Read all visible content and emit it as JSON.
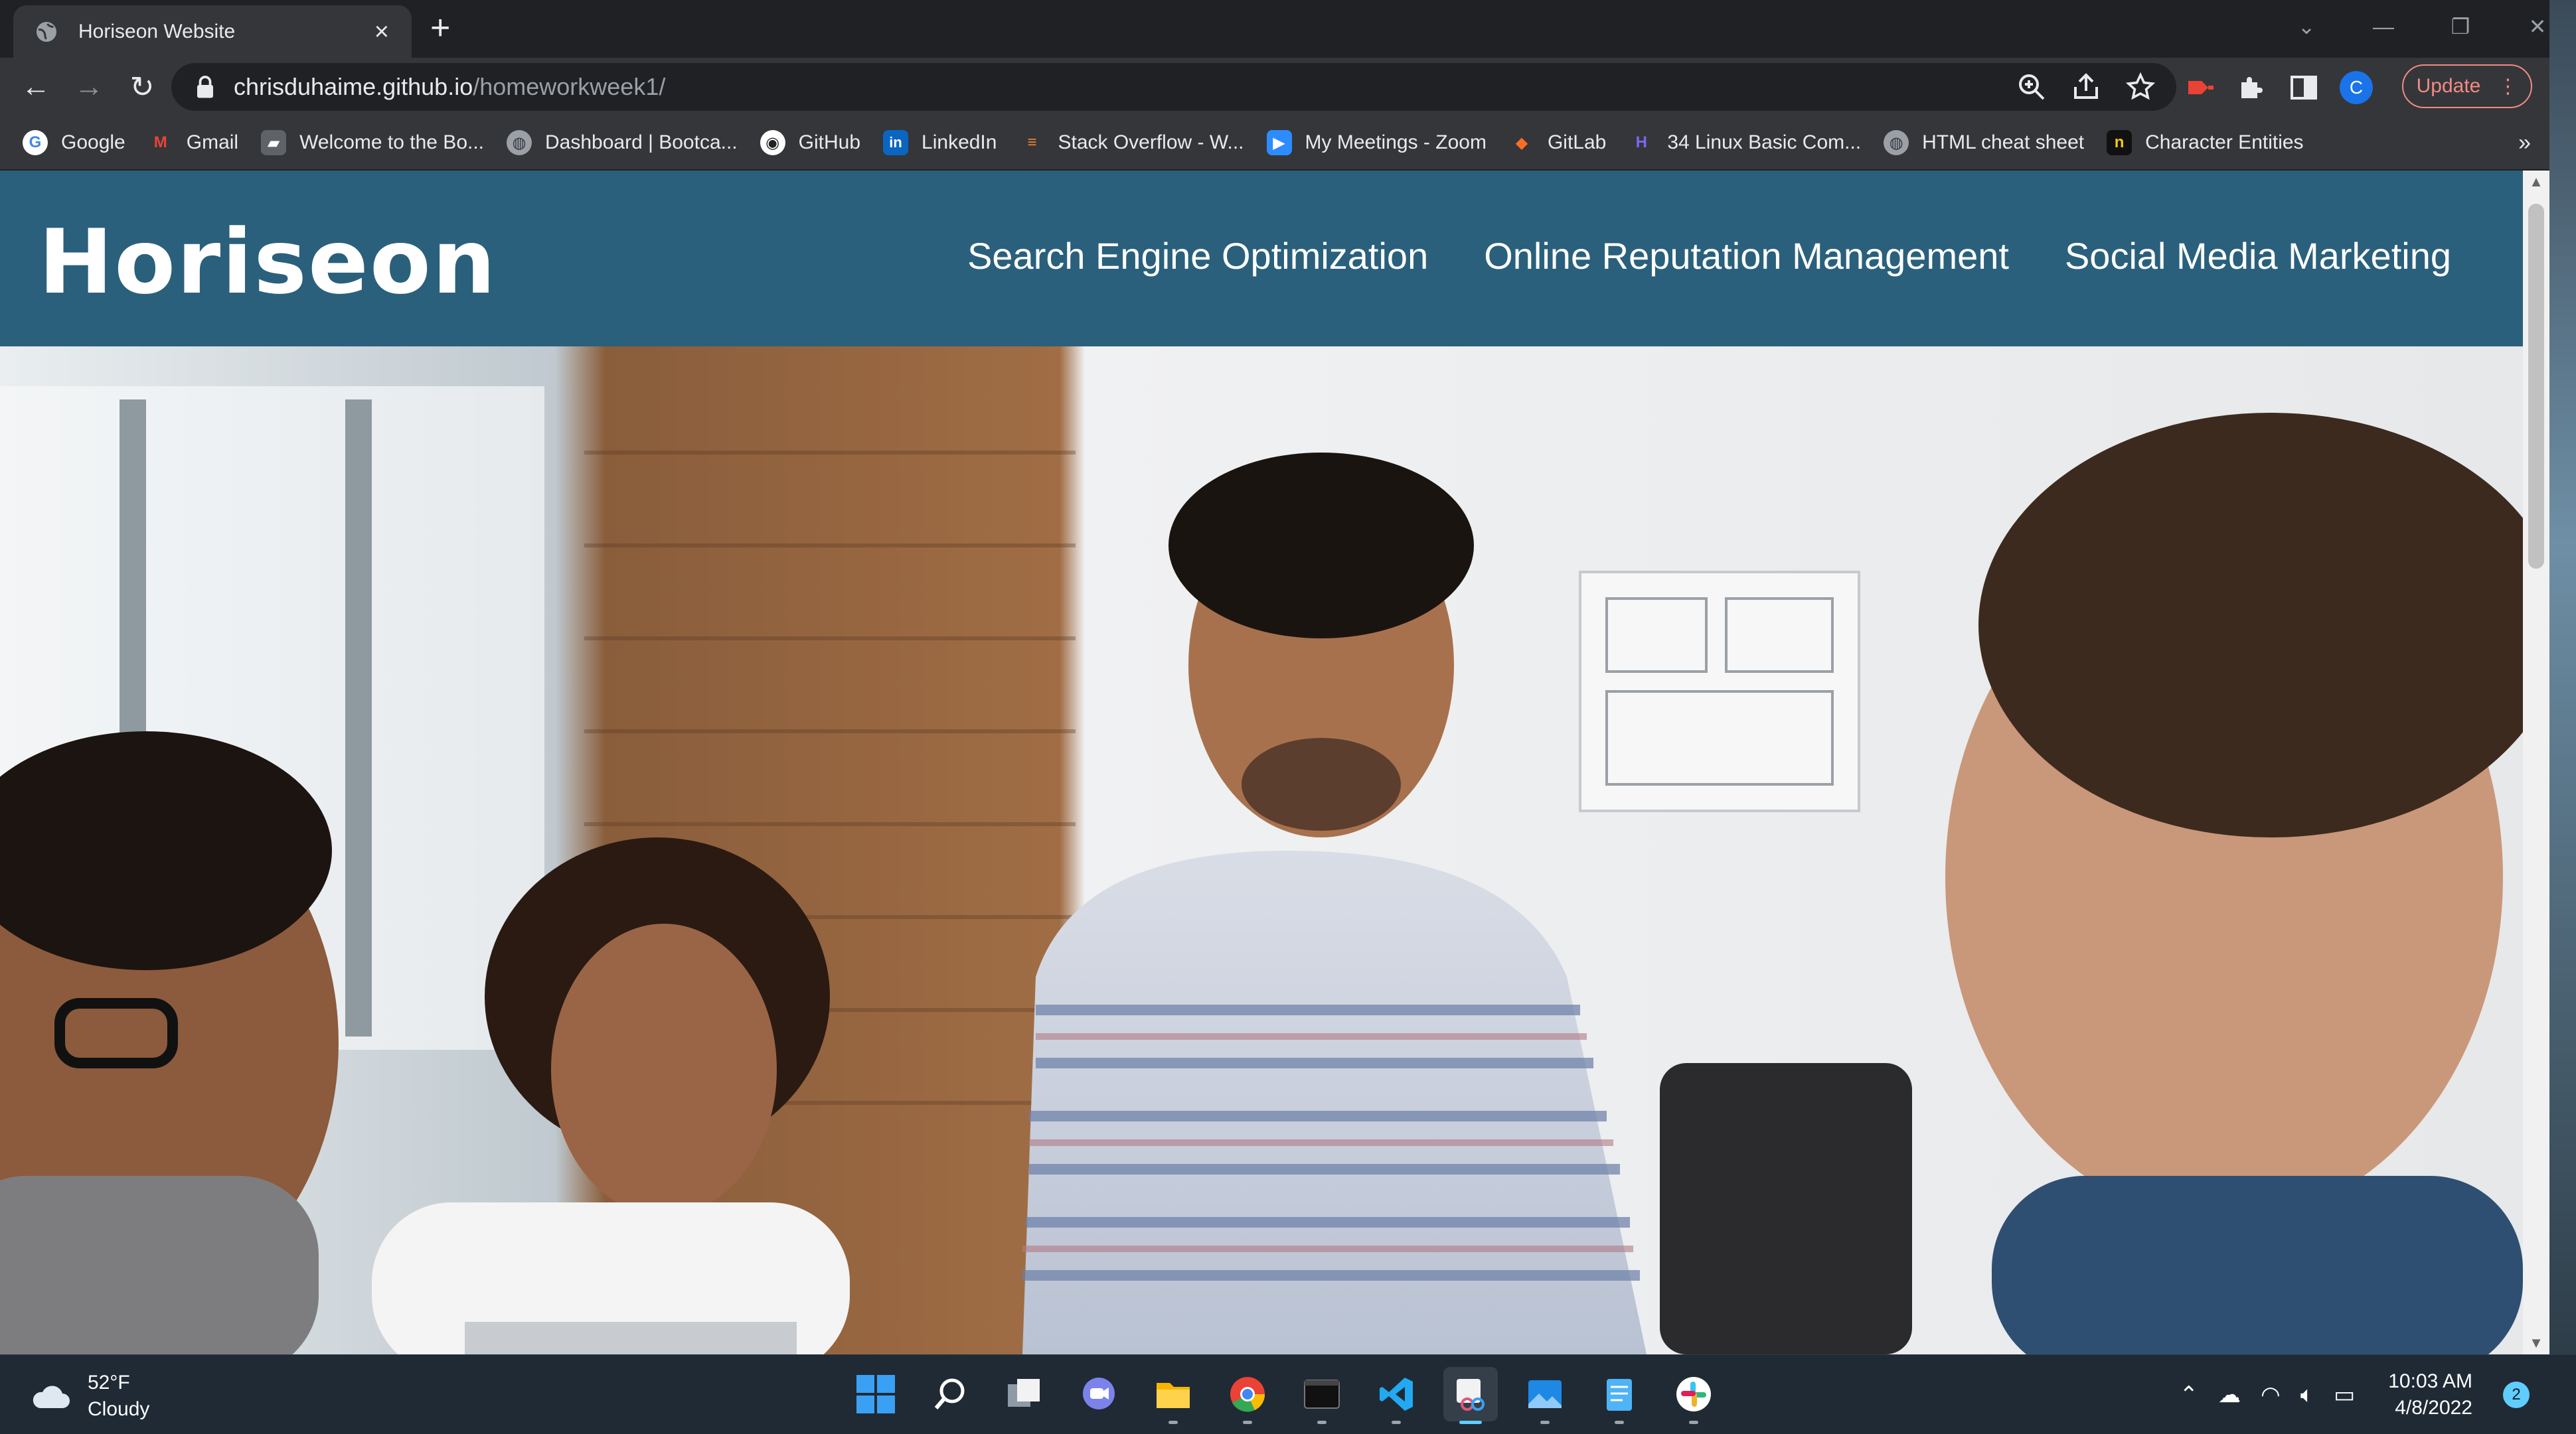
{
  "browser": {
    "tab_title": "Horiseon Website",
    "url_host": "chrisduhaime.github.io",
    "url_path": "/homeworkweek1/",
    "profile_initial": "C",
    "update_label": "Update",
    "bookmarks": [
      {
        "label": "Google",
        "icon": "google-icon"
      },
      {
        "label": "Gmail",
        "icon": "gmail-icon"
      },
      {
        "label": "Welcome to the Bo...",
        "icon": "book-icon"
      },
      {
        "label": "Dashboard | Bootca...",
        "icon": "globe-icon"
      },
      {
        "label": "GitHub",
        "icon": "github-icon"
      },
      {
        "label": "LinkedIn",
        "icon": "linkedin-icon"
      },
      {
        "label": "Stack Overflow - W...",
        "icon": "stackoverflow-icon"
      },
      {
        "label": "My Meetings - Zoom",
        "icon": "zoom-icon"
      },
      {
        "label": "GitLab",
        "icon": "gitlab-icon"
      },
      {
        "label": "34 Linux Basic Com...",
        "icon": "linux-icon"
      },
      {
        "label": "HTML cheat sheet",
        "icon": "globe-icon"
      },
      {
        "label": "Character Entities",
        "icon": "entities-icon"
      }
    ],
    "more_bookmarks": "»"
  },
  "site": {
    "logo": "Horiseon",
    "nav": [
      "Search Engine Optimization",
      "Online Reputation Management",
      "Social Media Marketing"
    ],
    "header_color": "#2a607c"
  },
  "taskbar": {
    "weather_temp": "52°F",
    "weather_desc": "Cloudy",
    "time": "10:03 AM",
    "date": "4/8/2022",
    "notifications": "2"
  }
}
